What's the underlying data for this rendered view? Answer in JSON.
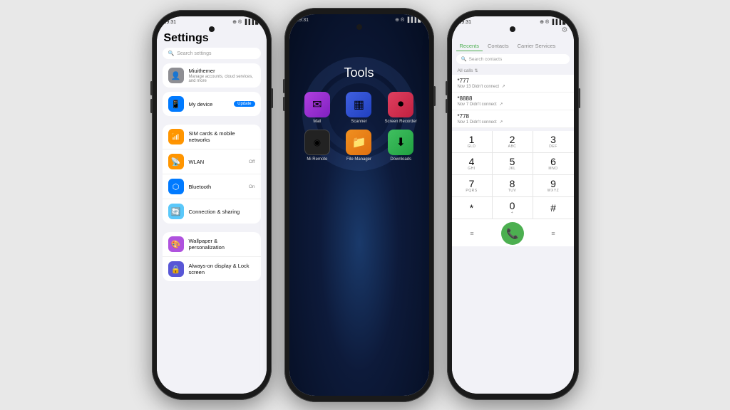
{
  "background": "#e8e8e8",
  "phone1": {
    "statusBar": {
      "time": "19:31",
      "icons": "⊕ ® ᵎil ■"
    },
    "title": "Settings",
    "search": {
      "placeholder": "Search settings"
    },
    "items": [
      {
        "id": "miuithemer",
        "label": "Miuithemer",
        "sub": "Manage accounts, cloud services, and more",
        "icon": "👤",
        "iconClass": "icon-gray",
        "right": ""
      },
      {
        "id": "my-device",
        "label": "My device",
        "sub": "",
        "icon": "📱",
        "iconClass": "icon-blue",
        "right": "Update"
      },
      {
        "id": "sim-cards",
        "label": "SIM cards & mobile networks",
        "sub": "",
        "icon": "📶",
        "iconClass": "icon-orange",
        "right": ""
      },
      {
        "id": "wlan",
        "label": "WLAN",
        "sub": "",
        "icon": "📡",
        "iconClass": "icon-orange",
        "right": "Off"
      },
      {
        "id": "bluetooth",
        "label": "Bluetooth",
        "sub": "",
        "icon": "⬡",
        "iconClass": "icon-blue3",
        "right": "On"
      },
      {
        "id": "connection-sharing",
        "label": "Connection & sharing",
        "sub": "",
        "icon": "🔄",
        "iconClass": "icon-teal",
        "right": ""
      },
      {
        "id": "wallpaper",
        "label": "Wallpaper & personalization",
        "sub": "",
        "icon": "🎨",
        "iconClass": "icon-purple",
        "right": ""
      },
      {
        "id": "always-on",
        "label": "Always-on display & Lock screen",
        "sub": "",
        "icon": "🔒",
        "iconClass": "icon-indigo",
        "right": ""
      }
    ]
  },
  "phone2": {
    "statusBar": {
      "time": "19:31",
      "icons": "⊕ ® ᵎil ■"
    },
    "title": "Tools",
    "apps": [
      {
        "id": "mail",
        "label": "Mail",
        "iconClass": "app-icon-mail",
        "icon": "✉"
      },
      {
        "id": "scanner",
        "label": "Scanner",
        "iconClass": "app-icon-scanner",
        "icon": "▦"
      },
      {
        "id": "screen-recorder",
        "label": "Screen Recorder",
        "iconClass": "app-icon-recorder",
        "icon": "⏺"
      },
      {
        "id": "mi-remote",
        "label": "Mi Remote",
        "iconClass": "app-icon-miremote",
        "icon": "◎"
      },
      {
        "id": "file-manager",
        "label": "File Manager",
        "iconClass": "app-icon-files",
        "icon": "📁"
      },
      {
        "id": "downloads",
        "label": "Downloads",
        "iconClass": "app-icon-downloads",
        "icon": "⬇"
      }
    ]
  },
  "phone3": {
    "statusBar": {
      "time": "19:31",
      "icons": "⊕ ® ᵎil ■"
    },
    "tabs": [
      "Recents",
      "Contacts",
      "Carrier Services"
    ],
    "activeTab": "Recents",
    "search": {
      "placeholder": "Search contacts"
    },
    "callsHeader": "All calls",
    "calls": [
      {
        "number": "*777",
        "detail": "Nov 13  Didn't connect"
      },
      {
        "number": "*8888",
        "detail": "Nov 7  Didn't connect"
      },
      {
        "number": "*778",
        "detail": "Nov 1  Didn't connect"
      }
    ],
    "dialKeys": [
      {
        "num": "1",
        "letters": "GLD"
      },
      {
        "num": "2",
        "letters": "ABC"
      },
      {
        "num": "3",
        "letters": "DEF"
      },
      {
        "num": "4",
        "letters": "GHI"
      },
      {
        "num": "5",
        "letters": "JKL"
      },
      {
        "num": "6",
        "letters": "MNO"
      },
      {
        "num": "7",
        "letters": "PQRS"
      },
      {
        "num": "8",
        "letters": "TUV"
      },
      {
        "num": "9",
        "letters": "WXYZ"
      },
      {
        "num": "*",
        "letters": ""
      },
      {
        "num": "0",
        "letters": "+"
      },
      {
        "num": "#",
        "letters": ""
      }
    ],
    "bottomActions": [
      "voicemail",
      "call",
      "backspace"
    ]
  }
}
